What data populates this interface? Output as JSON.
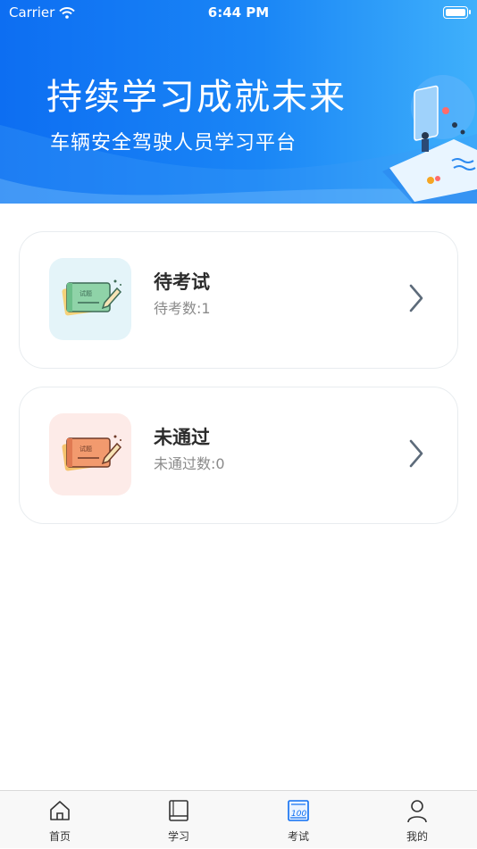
{
  "status_bar": {
    "carrier": "Carrier",
    "time": "6:44 PM"
  },
  "banner": {
    "title": "持续学习成就未来",
    "subtitle": "车辆安全驾驶人员学习平台"
  },
  "cards": [
    {
      "title": "待考试",
      "subtitle": "待考数:1",
      "accent": "#e4f4f9"
    },
    {
      "title": "未通过",
      "subtitle": "未通过数:0",
      "accent": "#fdebe8"
    }
  ],
  "card_icon_text": "试题",
  "tabbar": [
    {
      "label": "首页",
      "icon": "home-icon"
    },
    {
      "label": "学习",
      "icon": "book-icon"
    },
    {
      "label": "考试",
      "icon": "exam-icon",
      "selected": true
    },
    {
      "label": "我的",
      "icon": "user-icon"
    }
  ],
  "colors": {
    "brand_blue": "#0d6ef2",
    "chevron": "#5d6b7a"
  }
}
